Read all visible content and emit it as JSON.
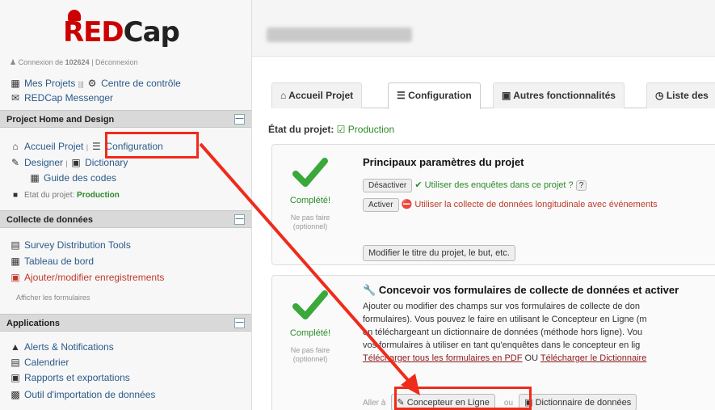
{
  "sidebar": {
    "logo": {
      "brand": "REDCap",
      "brand_a": "RED",
      "brand_b": "Cap"
    },
    "login": {
      "label": "Connexion de",
      "user": "102624",
      "logout": "Déconnexion"
    },
    "nav": {
      "my_projects": "Mes Projets",
      "control_center": "Centre de contrôle",
      "messenger": "REDCap Messenger"
    },
    "sections": [
      {
        "title": "Project Home and Design"
      },
      {
        "title": "Collecte de données"
      },
      {
        "title": "Applications"
      }
    ],
    "project_home": {
      "home": "Accueil Projet",
      "config": "Configuration",
      "designer": "Designer",
      "dictionary": "Dictionary",
      "codebook": "Guide des codes",
      "status_label": "Etat du projet:",
      "status_value": "Production"
    },
    "data_collection": {
      "survey_tools": "Survey Distribution Tools",
      "dashboard": "Tableau de bord",
      "add_edit": "Ajouter/modifier enregistrements",
      "show_forms": "Afficher les formulaires"
    },
    "applications": {
      "alerts": "Alerts & Notifications",
      "calendar": "Calendrier",
      "reports": "Rapports et exportations",
      "import_tool": "Outil d'importation de données"
    }
  },
  "tabs": [
    {
      "label": "Accueil Projet",
      "icon": "home-icon"
    },
    {
      "label": "Configuration",
      "icon": "list-icon"
    },
    {
      "label": "Autres fonctionnalités",
      "icon": "briefcase-icon"
    },
    {
      "label": "Liste des",
      "icon": "clock-icon"
    }
  ],
  "status": {
    "label": "État du projet:",
    "value": "Production"
  },
  "panel1": {
    "status": "Complété!",
    "faded": "Ne pas faire",
    "faded2": "(optionnel)",
    "title": "Principaux paramètres du projet",
    "btn_disable": "Désactiver",
    "opt1": "Utiliser des enquêtes dans ce projet ?",
    "opt1_help": "?",
    "btn_enable": "Activer",
    "opt2": "Utiliser la collecte de données longitudinale avec événements",
    "modify_btn": "Modifier le titre du projet, le but, etc."
  },
  "panel2": {
    "status": "Complété!",
    "faded": "Ne pas faire",
    "faded2": "(optionnel)",
    "title": "Concevoir vos formulaires de collecte de données et activer",
    "body1": "Ajouter ou modifier des champs sur vos formulaires de collecte de don",
    "body2": "formulaires). Vous pouvez le faire en utilisant le Concepteur en Ligne (m",
    "body3": "en téléchargeant un dictionnaire de données (méthode hors ligne). Vou",
    "body4": "vos formulaires à utiliser en tant qu'enquêtes dans le concepteur en lig",
    "link_pdf": "Télécharger tous les formulaires en PDF",
    "or": "OU",
    "link_dict": "Télécharger le Dictionnaire",
    "go_to": "Aller à",
    "designer_btn": "Concepteur en Ligne",
    "or2": "ou",
    "dict_btn": "Dictionnaire de données"
  },
  "colors": {
    "accent": "#ef2b1b",
    "complete": "#2a8a2a",
    "brand": "#cc0000"
  }
}
